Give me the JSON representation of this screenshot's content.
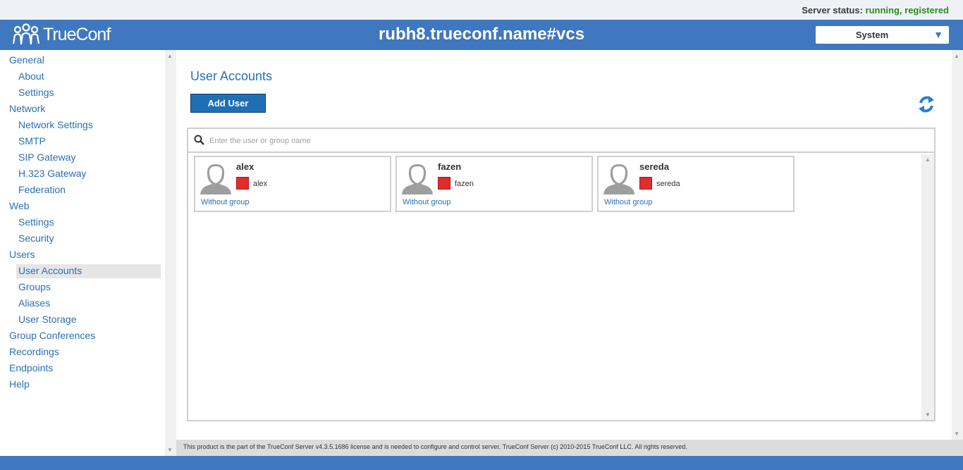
{
  "status": {
    "label": "Server status:",
    "value": "running, registered"
  },
  "header": {
    "logo_text": "TrueConf",
    "server_name": "rubh8.trueconf.name#vcs",
    "system_select": "System"
  },
  "sidebar": {
    "items": [
      {
        "label": "General",
        "level": 0
      },
      {
        "label": "About",
        "level": 1
      },
      {
        "label": "Settings",
        "level": 1
      },
      {
        "label": "Network",
        "level": 0
      },
      {
        "label": "Network Settings",
        "level": 1
      },
      {
        "label": "SMTP",
        "level": 1
      },
      {
        "label": "SIP Gateway",
        "level": 1
      },
      {
        "label": "H.323 Gateway",
        "level": 1
      },
      {
        "label": "Federation",
        "level": 1
      },
      {
        "label": "Web",
        "level": 0
      },
      {
        "label": "Settings",
        "level": 1
      },
      {
        "label": "Security",
        "level": 1
      },
      {
        "label": "Users",
        "level": 0
      },
      {
        "label": "User Accounts",
        "level": 1
      },
      {
        "label": "Groups",
        "level": 1
      },
      {
        "label": "Aliases",
        "level": 1
      },
      {
        "label": "User Storage",
        "level": 1
      },
      {
        "label": "Group Conferences",
        "level": 0
      },
      {
        "label": "Recordings",
        "level": 0
      },
      {
        "label": "Endpoints",
        "level": 0
      },
      {
        "label": "Help",
        "level": 0
      }
    ]
  },
  "main": {
    "title": "User Accounts",
    "add_button": "Add User",
    "search_placeholder": "Enter the user or group name",
    "users": [
      {
        "name": "alex",
        "login": "alex",
        "group": "Without group",
        "status_color": "#e02c2c"
      },
      {
        "name": "fazen",
        "login": "fazen",
        "group": "Without group",
        "status_color": "#e02c2c"
      },
      {
        "name": "sereda",
        "login": "sereda",
        "group": "Without group",
        "status_color": "#e02c2c"
      }
    ]
  },
  "footer": {
    "text": "This product is the part of the TrueConf Server v4.3.5.1686 license and is needed to configure and control server. TrueConf Server (c) 2010-2015 TrueConf LLC. All rights reserved."
  },
  "colors": {
    "brand": "#3f78bf",
    "link": "#2a6fb5",
    "status_ok": "#2c8a1e",
    "offline": "#e02c2c"
  }
}
